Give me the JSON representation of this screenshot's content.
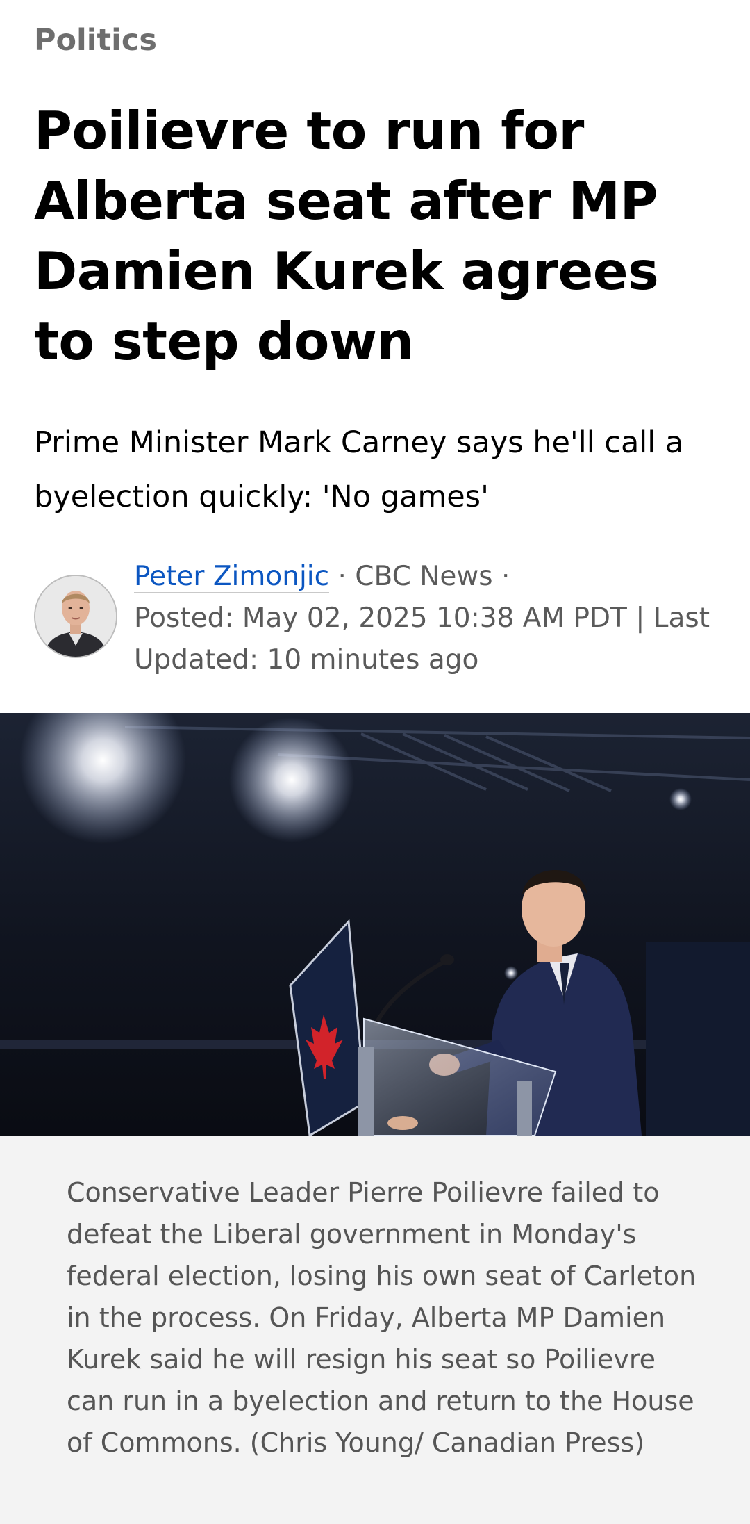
{
  "article": {
    "section": "Politics",
    "headline": "Poilievre to run for Alberta seat after MP Damien Kurek agrees to step down",
    "deck": "Prime Minister Mark Carney says he'll call a byelection quickly: 'No games'",
    "byline": {
      "author": "Peter Zimonjic",
      "separator": "·",
      "outlet": "CBC News",
      "posted": "Posted: May 02, 2025 10:38 AM PDT | Last Updated: 10 minutes ago"
    },
    "photo": {
      "caption": "Conservative Leader Pierre Poilievre failed to defeat the Liberal government in Monday's federal election, losing his own seat of Carleton in the process. On Friday, Alberta MP Damien Kurek said he will resign his seat so Poilievre can run in a byelection and return to the House of Commons. (Chris Young/ Canadian Press)"
    }
  },
  "colors": {
    "section": "#6e6e6e",
    "author_link": "#0b56c1",
    "meta_text": "#5a5a5a",
    "caption_bg": "#f3f3f3",
    "caption_text": "#555555"
  }
}
